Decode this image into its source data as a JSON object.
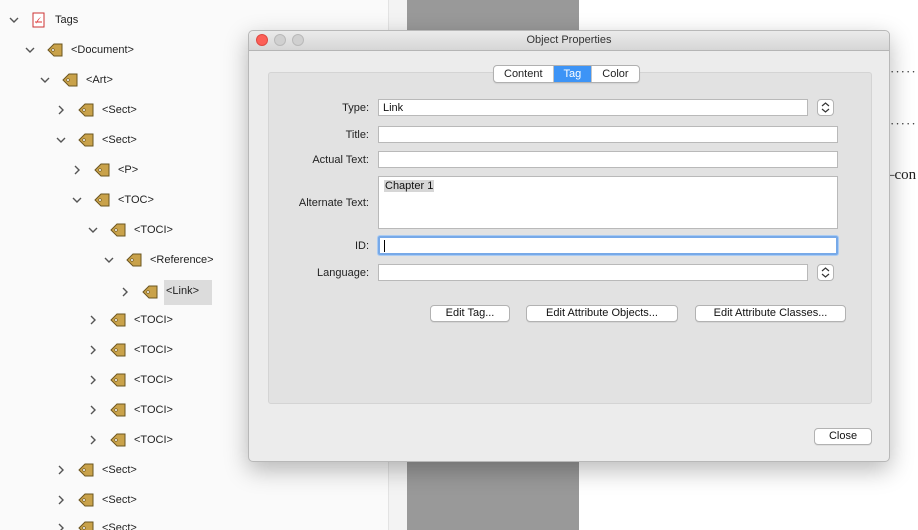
{
  "tree": {
    "items": [
      {
        "label": "Tags",
        "icon": "pdf-icon",
        "chevron": "down"
      },
      {
        "label": "<Document>",
        "icon": "tag-icon",
        "chevron": "down"
      },
      {
        "label": "<Art>",
        "icon": "tag-icon",
        "chevron": "down"
      },
      {
        "label": "<Sect>",
        "icon": "tag-icon",
        "chevron": "right"
      },
      {
        "label": "<Sect>",
        "icon": "tag-icon",
        "chevron": "down"
      },
      {
        "label": "<P>",
        "icon": "tag-icon",
        "chevron": "right"
      },
      {
        "label": "<TOC>",
        "icon": "tag-icon",
        "chevron": "down"
      },
      {
        "label": "<TOCI>",
        "icon": "tag-icon",
        "chevron": "down"
      },
      {
        "label": "<Reference>",
        "icon": "tag-icon",
        "chevron": "down"
      },
      {
        "label": "<Link>",
        "icon": "tag-icon",
        "chevron": "right",
        "selected": true
      },
      {
        "label": "<TOCI>",
        "icon": "tag-icon",
        "chevron": "right"
      },
      {
        "label": "<TOCI>",
        "icon": "tag-icon",
        "chevron": "right"
      },
      {
        "label": "<TOCI>",
        "icon": "tag-icon",
        "chevron": "right"
      },
      {
        "label": "<TOCI>",
        "icon": "tag-icon",
        "chevron": "right"
      },
      {
        "label": "<TOCI>",
        "icon": "tag-icon",
        "chevron": "right"
      },
      {
        "label": "<Sect>",
        "icon": "tag-icon",
        "chevron": "right"
      },
      {
        "label": "<Sect>",
        "icon": "tag-icon",
        "chevron": "right"
      },
      {
        "label": "<Sect>",
        "icon": "tag-icon",
        "chevron": "right"
      }
    ]
  },
  "document": {
    "dots": "·········",
    "fragment": "–con"
  },
  "dialog": {
    "title": "Object Properties",
    "tabs": [
      {
        "label": "Content",
        "active": false
      },
      {
        "label": "Tag",
        "active": true
      },
      {
        "label": "Color",
        "active": false
      }
    ],
    "fields": {
      "type_label": "Type:",
      "type_value": "Link",
      "title_label": "Title:",
      "title_value": "",
      "actual_text_label": "Actual Text:",
      "actual_text_value": "",
      "alt_text_label": "Alternate Text:",
      "alt_text_value": "Chapter 1",
      "id_label": "ID:",
      "id_value": "",
      "language_label": "Language:",
      "language_value": ""
    },
    "buttons": {
      "edit_tag": "Edit Tag...",
      "edit_attr_objects": "Edit Attribute Objects...",
      "edit_attr_classes": "Edit Attribute Classes...",
      "close": "Close"
    }
  },
  "colors": {
    "active_tab": "#3d94f6",
    "close_light": "#fc5f57",
    "focus_ring": "#77a9e8",
    "tag_icon": "#c9a24a"
  }
}
